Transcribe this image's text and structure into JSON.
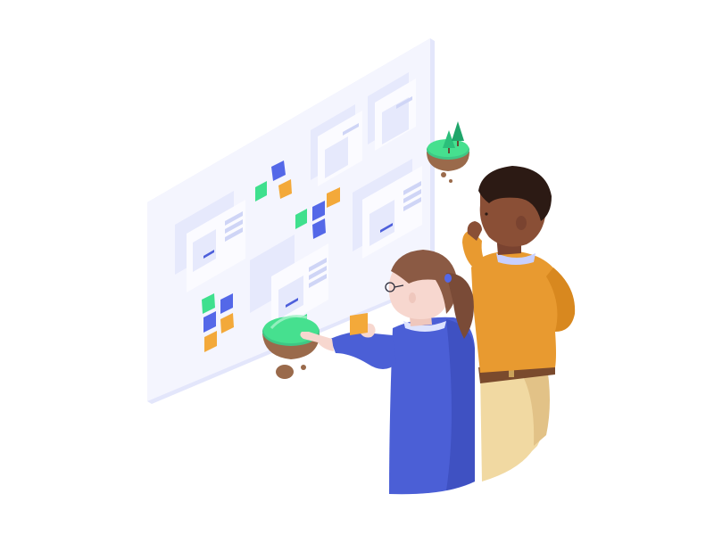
{
  "scene": {
    "subject": "isometric-collaboration-board",
    "colors": {
      "background": "#ffffff",
      "board_face": "#f4f5fe",
      "board_edge": "#e3e6fb",
      "card": "#e6e9fc",
      "card_light": "#fbfbff",
      "card_line": "#cfd5f6",
      "accent_blue": "#4d5fdb",
      "note_green": "#3fe08e",
      "note_blue": "#5468e8",
      "note_orange": "#f3a93a",
      "island_grass": "#46e08f",
      "island_dirt": "#9a6a4b",
      "tree": "#2bbf7a",
      "skin_woman": "#f7d7cf",
      "hair_woman": "#8b5a44",
      "top_woman": "#4b5fd6",
      "skin_man": "#8a4f36",
      "hair_man": "#2c1a14",
      "top_man": "#e89a30",
      "pants_man": "#f1d9a2",
      "belt": "#7a4a2d"
    }
  }
}
